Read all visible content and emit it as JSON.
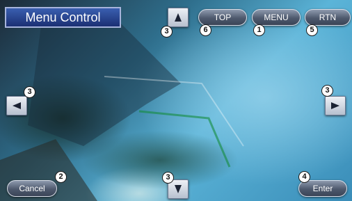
{
  "window": {
    "title": "Menu Control"
  },
  "buttons": {
    "top": "TOP",
    "menu": "MENU",
    "rtn": "RTN",
    "cancel": "Cancel",
    "enter": "Enter"
  },
  "callouts": {
    "up": "3",
    "top": "6",
    "menu": "1",
    "rtn": "5",
    "left": "3",
    "right": "3",
    "cancel": "2",
    "down": "3",
    "enter": "4"
  },
  "icons": {
    "up": "arrow-up-icon",
    "down": "arrow-down-icon",
    "left": "arrow-left-icon",
    "right": "arrow-right-icon"
  },
  "colors": {
    "title_bg": "#1b2f73",
    "button": "#4e596d",
    "arrow_key": "#d6dbe4"
  }
}
